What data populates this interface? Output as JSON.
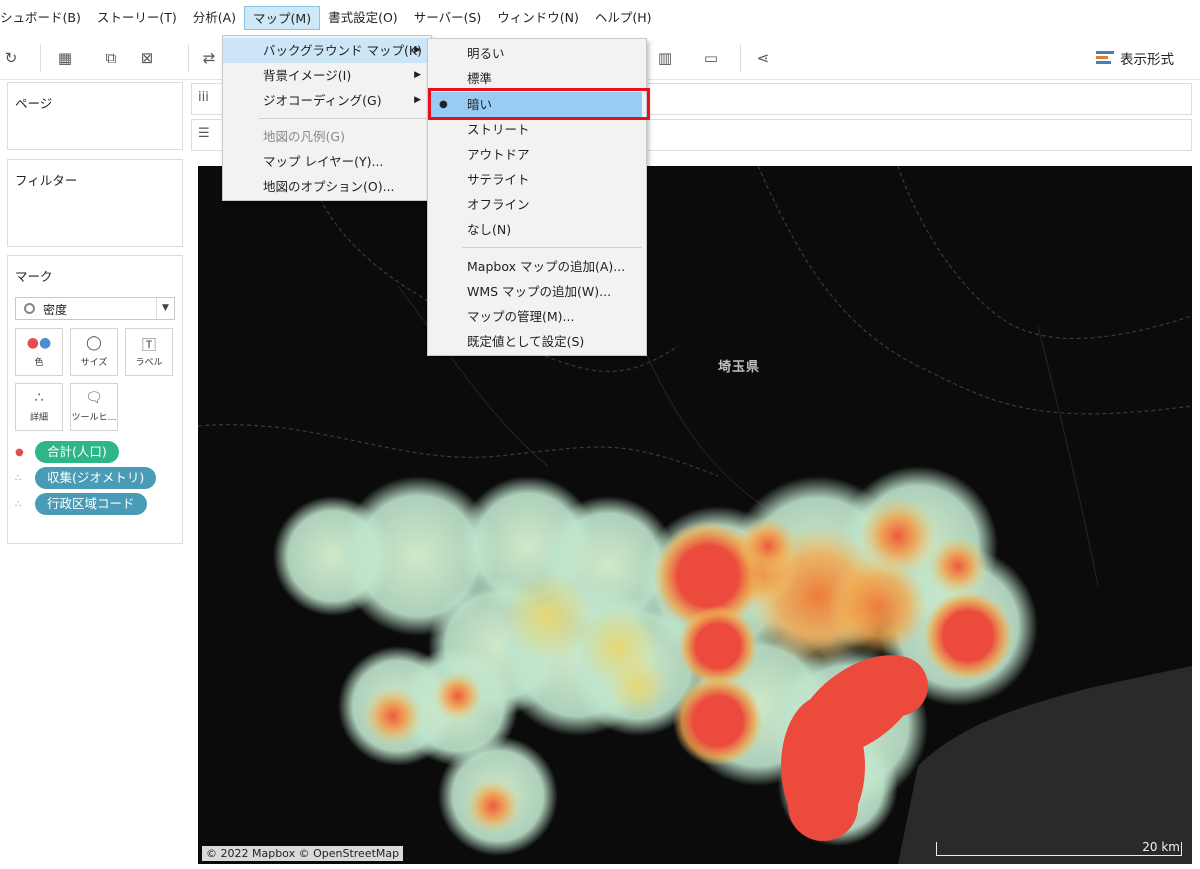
{
  "menubar": {
    "items": [
      {
        "label": "シュボード(B)"
      },
      {
        "label": "ストーリー(T)"
      },
      {
        "label": "分析(A)"
      },
      {
        "label": "マップ(M)",
        "active": true
      },
      {
        "label": "書式設定(O)"
      },
      {
        "label": "サーバー(S)"
      },
      {
        "label": "ウィンドウ(N)"
      },
      {
        "label": "ヘルプ(H)"
      }
    ]
  },
  "toolbar": {
    "show_me_label": "表示形式"
  },
  "left_pane": {
    "pages_title": "ページ",
    "filters_title": "フィルター",
    "marks_title": "マーク",
    "mark_type": "密度",
    "mark_buttons": [
      {
        "label": "色",
        "icon": "color-dots-icon"
      },
      {
        "label": "サイズ",
        "icon": "size-icon"
      },
      {
        "label": "ラベル",
        "icon": "label-icon"
      },
      {
        "label": "詳細",
        "icon": "detail-icon"
      },
      {
        "label": "ツールヒ…",
        "icon": "tooltip-icon"
      }
    ],
    "pills": [
      {
        "label": "合計(人口)",
        "color": "#2fb58a",
        "icon": "color-dots-icon"
      },
      {
        "label": "収集(ジオメトリ)",
        "color": "#4a9bb5",
        "icon": "detail-icon"
      },
      {
        "label": "行政区域コード",
        "color": "#4a9bb5",
        "icon": "detail-icon"
      }
    ]
  },
  "map_menu": {
    "items": [
      {
        "label": "バックグラウンド マップ(K)",
        "submenu": true,
        "highlighted": true
      },
      {
        "label": "背景イメージ(I)",
        "submenu": true
      },
      {
        "label": "ジオコーディング(G)",
        "submenu": true
      },
      {
        "label": "地図の凡例(G)",
        "disabled": true
      },
      {
        "label": "マップ レイヤー(Y)..."
      },
      {
        "label": "地図のオプション(O)..."
      }
    ]
  },
  "background_submenu": {
    "items": [
      {
        "label": "明るい"
      },
      {
        "label": "標準"
      },
      {
        "label": "暗い",
        "checked": true
      },
      {
        "label": "ストリート"
      },
      {
        "label": "アウトドア"
      },
      {
        "label": "サテライト"
      },
      {
        "label": "オフライン"
      },
      {
        "label": "なし(N)"
      },
      {
        "label": "Mapbox マップの追加(A)..."
      },
      {
        "label": "WMS マップの追加(W)..."
      },
      {
        "label": "マップの管理(M)..."
      },
      {
        "label": "既定値として設定(S)"
      }
    ]
  },
  "map": {
    "region_label": "埼玉県",
    "attribution": "© 2022 Mapbox © OpenStreetMap",
    "scale_label": "20 km"
  }
}
